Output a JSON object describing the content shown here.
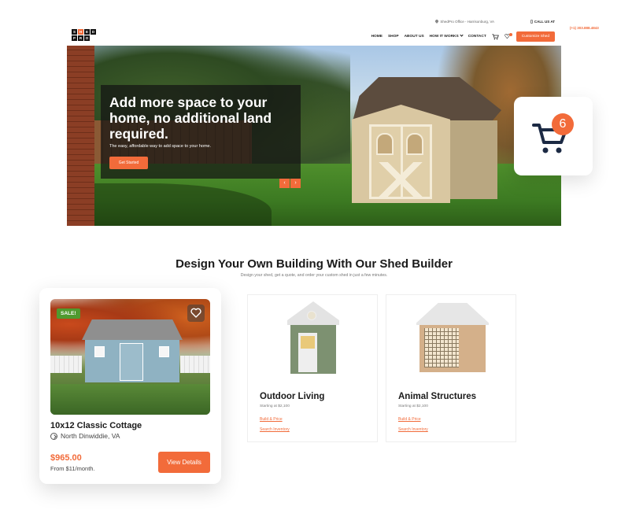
{
  "topbar": {
    "office": "ShedPro Office - Harrisonburg, VA",
    "call_label": "CALL US AT",
    "phone": "(+1) 303.888.4843"
  },
  "logo": {
    "letters": [
      "S",
      "H",
      "E",
      "D",
      "P",
      "R",
      "O"
    ]
  },
  "nav": {
    "items": [
      "HOME",
      "SHOP",
      "ABOUT US",
      "HOW IT WORKS",
      "CONTACT"
    ],
    "cta": "Customize Shed"
  },
  "hero": {
    "headline": "Add more space to your home, no additional land required.",
    "subtext": "The easy, affordable way to add space to your home.",
    "button": "Get Started",
    "prev": "‹",
    "next": "›"
  },
  "cart_widget": {
    "count": "6",
    "icon": "cart-icon"
  },
  "section": {
    "title": "Design Your Own Building With Our Shed Builder",
    "subtitle": "Design your shed, get a quote, and order your custom shed in just a few minutes."
  },
  "categories": [
    {
      "title": "Outdoor Living",
      "price": "Starting at $2,100",
      "link1": "Build & Price",
      "link2": "Search Inventory"
    },
    {
      "title": "Animal Structures",
      "price": "Starting at $2,100",
      "link1": "Build & Price",
      "link2": "Search Inventory"
    }
  ],
  "product": {
    "badge": "SALE!",
    "name": "10x12 Classic Cottage",
    "location": "North Dinwiddie, VA",
    "price": "$965.00",
    "monthly": "From $11/month.",
    "button": "View Details"
  },
  "colors": {
    "accent": "#f26b3a",
    "sale_green": "#4f9a2f"
  }
}
